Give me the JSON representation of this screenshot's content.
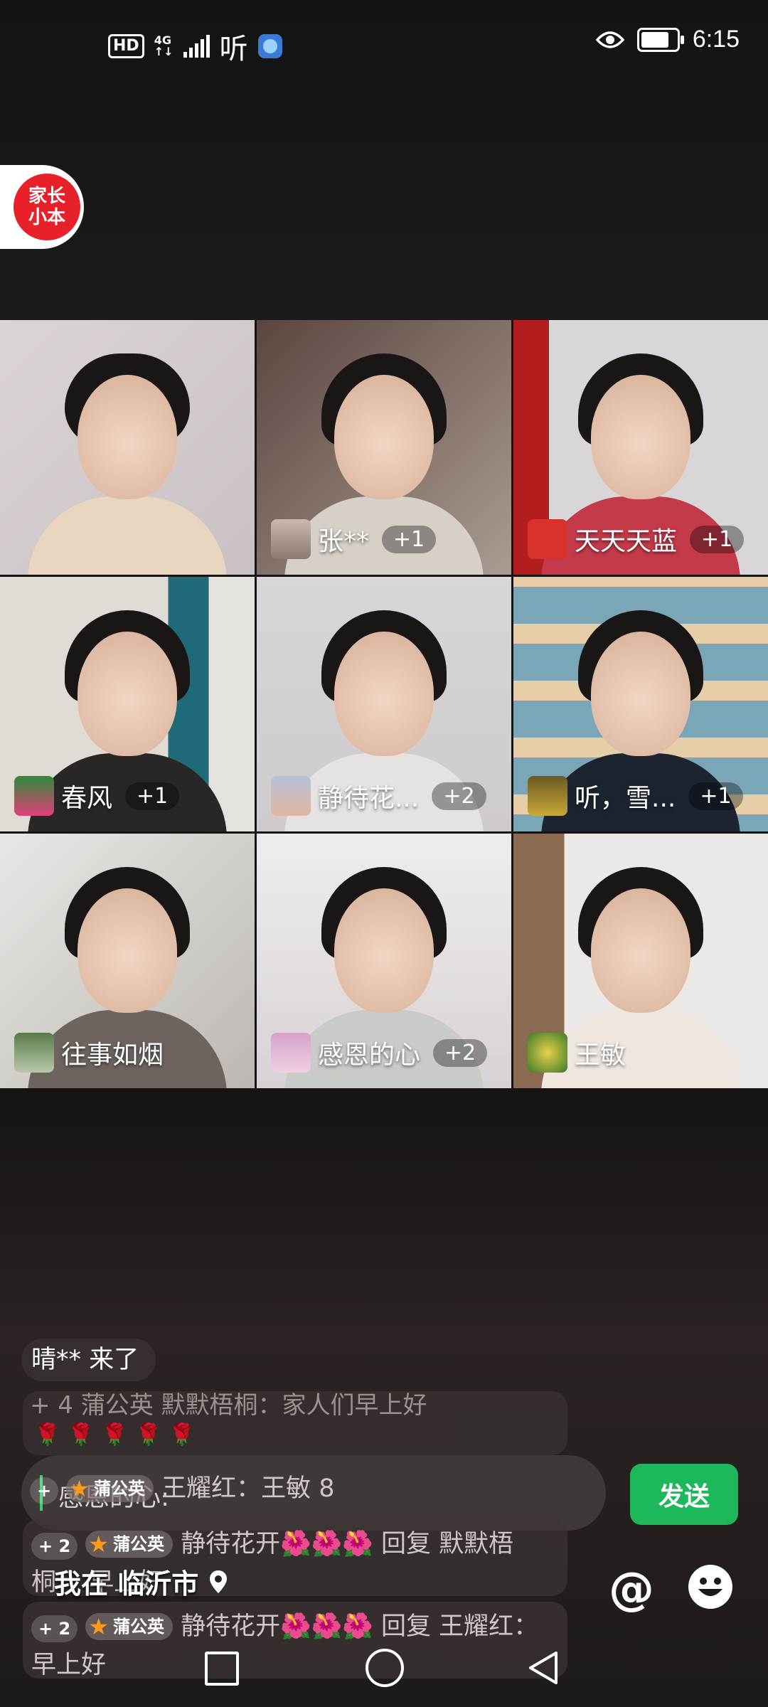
{
  "status_bar": {
    "hd": "HD",
    "network_top": "4G",
    "network_bottom": "↑↓",
    "app_icon": "听",
    "time": "6:15"
  },
  "logo": {
    "line1": "家长",
    "line2": "小本"
  },
  "participants": [
    {
      "name": "",
      "likes": ""
    },
    {
      "name": "张**",
      "likes": "+1"
    },
    {
      "name": "天天天蓝",
      "likes": "+1"
    },
    {
      "name": "春风",
      "likes": "+1"
    },
    {
      "name": "静待花...",
      "likes": "+2"
    },
    {
      "name": "听，雪...",
      "likes": "+1"
    },
    {
      "name": "往事如烟",
      "likes": ""
    },
    {
      "name": "感恩的心",
      "likes": "+2"
    },
    {
      "name": "王敏",
      "likes": ""
    }
  ],
  "chat": {
    "join_notice": "晴** 来了",
    "msg_faded": "+ 4   蒲公英  默默梧桐：家人们早上好",
    "msg2": {
      "level": "+",
      "badge_num": "8",
      "badge": "蒲公英",
      "text": "王耀红：王敏 8"
    },
    "msg3": {
      "level": "+ 2",
      "badge_num": "8",
      "badge": "蒲公英",
      "text": "静待花开🌺🌺🌺 回复 默默梧桐：",
      "suffix": "早上好"
    },
    "msg4": {
      "level": "+ 2",
      "badge_num": "8",
      "badge": "蒲公英",
      "text": "静待花开🌺🌺🌺 回复 王耀红：早上好"
    }
  },
  "input": {
    "text": "感恩的心:"
  },
  "send_label": "发送",
  "location": "我在 临沂市",
  "colors": {
    "accent": "#1db85c",
    "logo": "#e8202a"
  }
}
